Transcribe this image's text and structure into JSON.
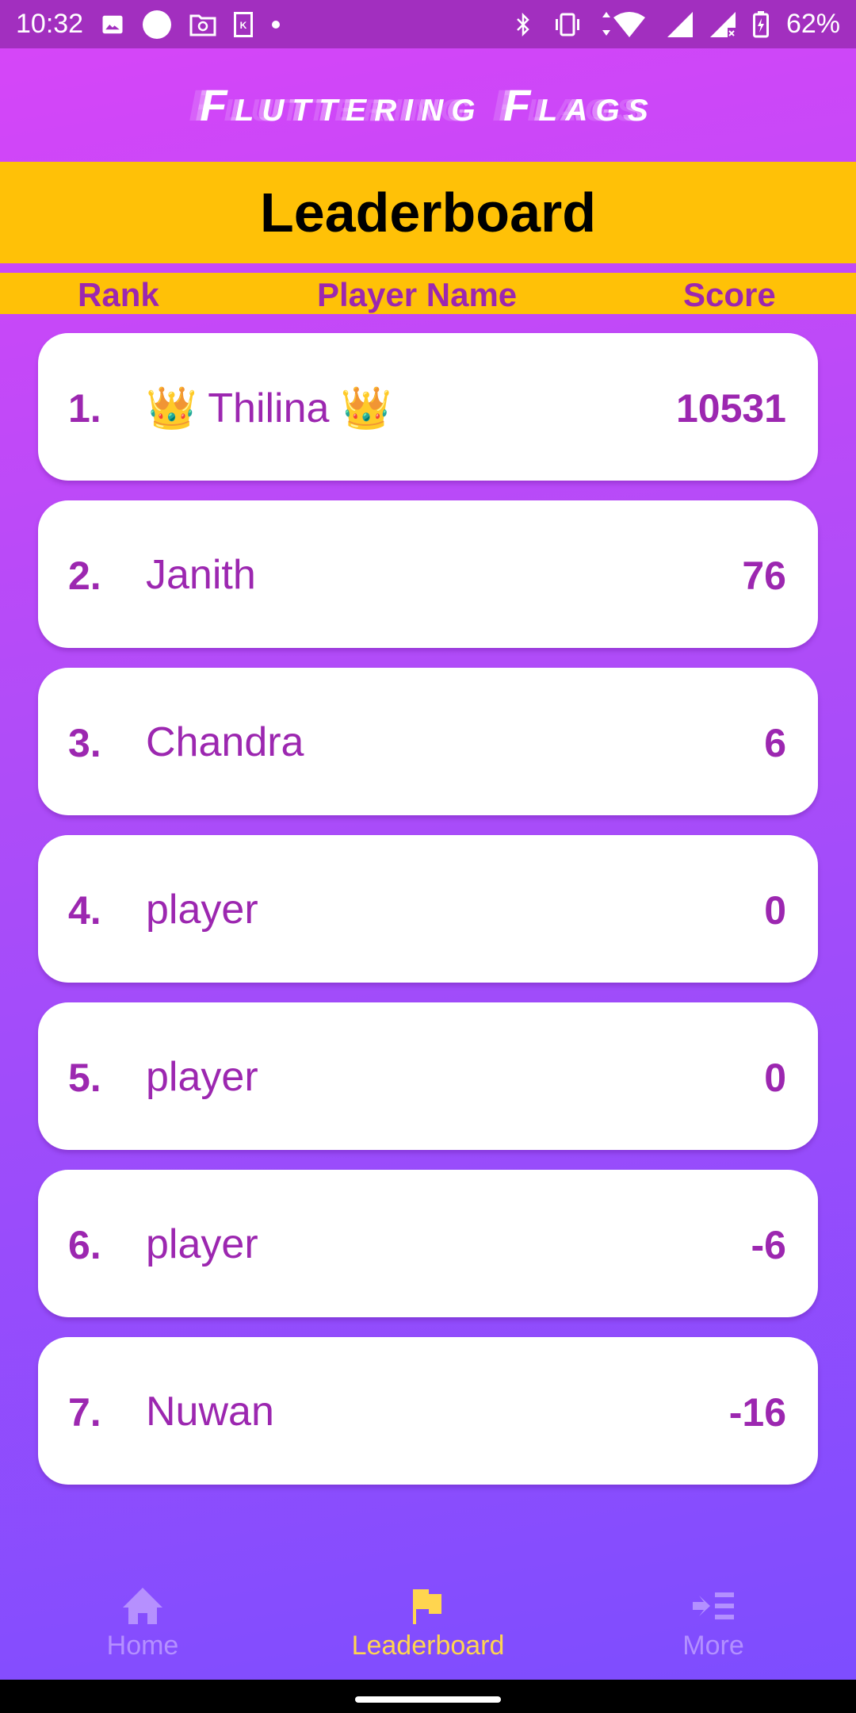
{
  "status_bar": {
    "time": "10:32",
    "battery": "62%",
    "left_icons": [
      "image-icon",
      "circle-icon",
      "folder-sync-icon",
      "k-app-icon",
      "dot-icon"
    ],
    "right_icons": [
      "bluetooth-icon",
      "vibrate-icon",
      "data-arrows-icon",
      "wifi-icon",
      "signal-icon",
      "signal-no-data-icon",
      "battery-charging-icon"
    ]
  },
  "app": {
    "title": "Fluttering Flags"
  },
  "leaderboard": {
    "title": "Leaderboard",
    "columns": {
      "rank": "Rank",
      "player": "Player Name",
      "score": "Score"
    },
    "rows": [
      {
        "rank": "1.",
        "name": "👑 Thilina 👑",
        "score": "10531"
      },
      {
        "rank": "2.",
        "name": "Janith",
        "score": "76"
      },
      {
        "rank": "3.",
        "name": "Chandra",
        "score": "6"
      },
      {
        "rank": "4.",
        "name": "player",
        "score": "0"
      },
      {
        "rank": "5.",
        "name": "player",
        "score": "0"
      },
      {
        "rank": "6.",
        "name": "player",
        "score": "-6"
      },
      {
        "rank": "7.",
        "name": "Nuwan",
        "score": "-16"
      }
    ]
  },
  "nav": {
    "items": [
      {
        "label": "Home",
        "icon": "home-icon",
        "active": false
      },
      {
        "label": "Leaderboard",
        "icon": "flag-icon",
        "active": true
      },
      {
        "label": "More",
        "icon": "more-menu-icon",
        "active": false
      }
    ]
  },
  "colors": {
    "accent": "#ffc107",
    "text_purple": "#9c27b0",
    "active_nav": "#ffd54f"
  }
}
